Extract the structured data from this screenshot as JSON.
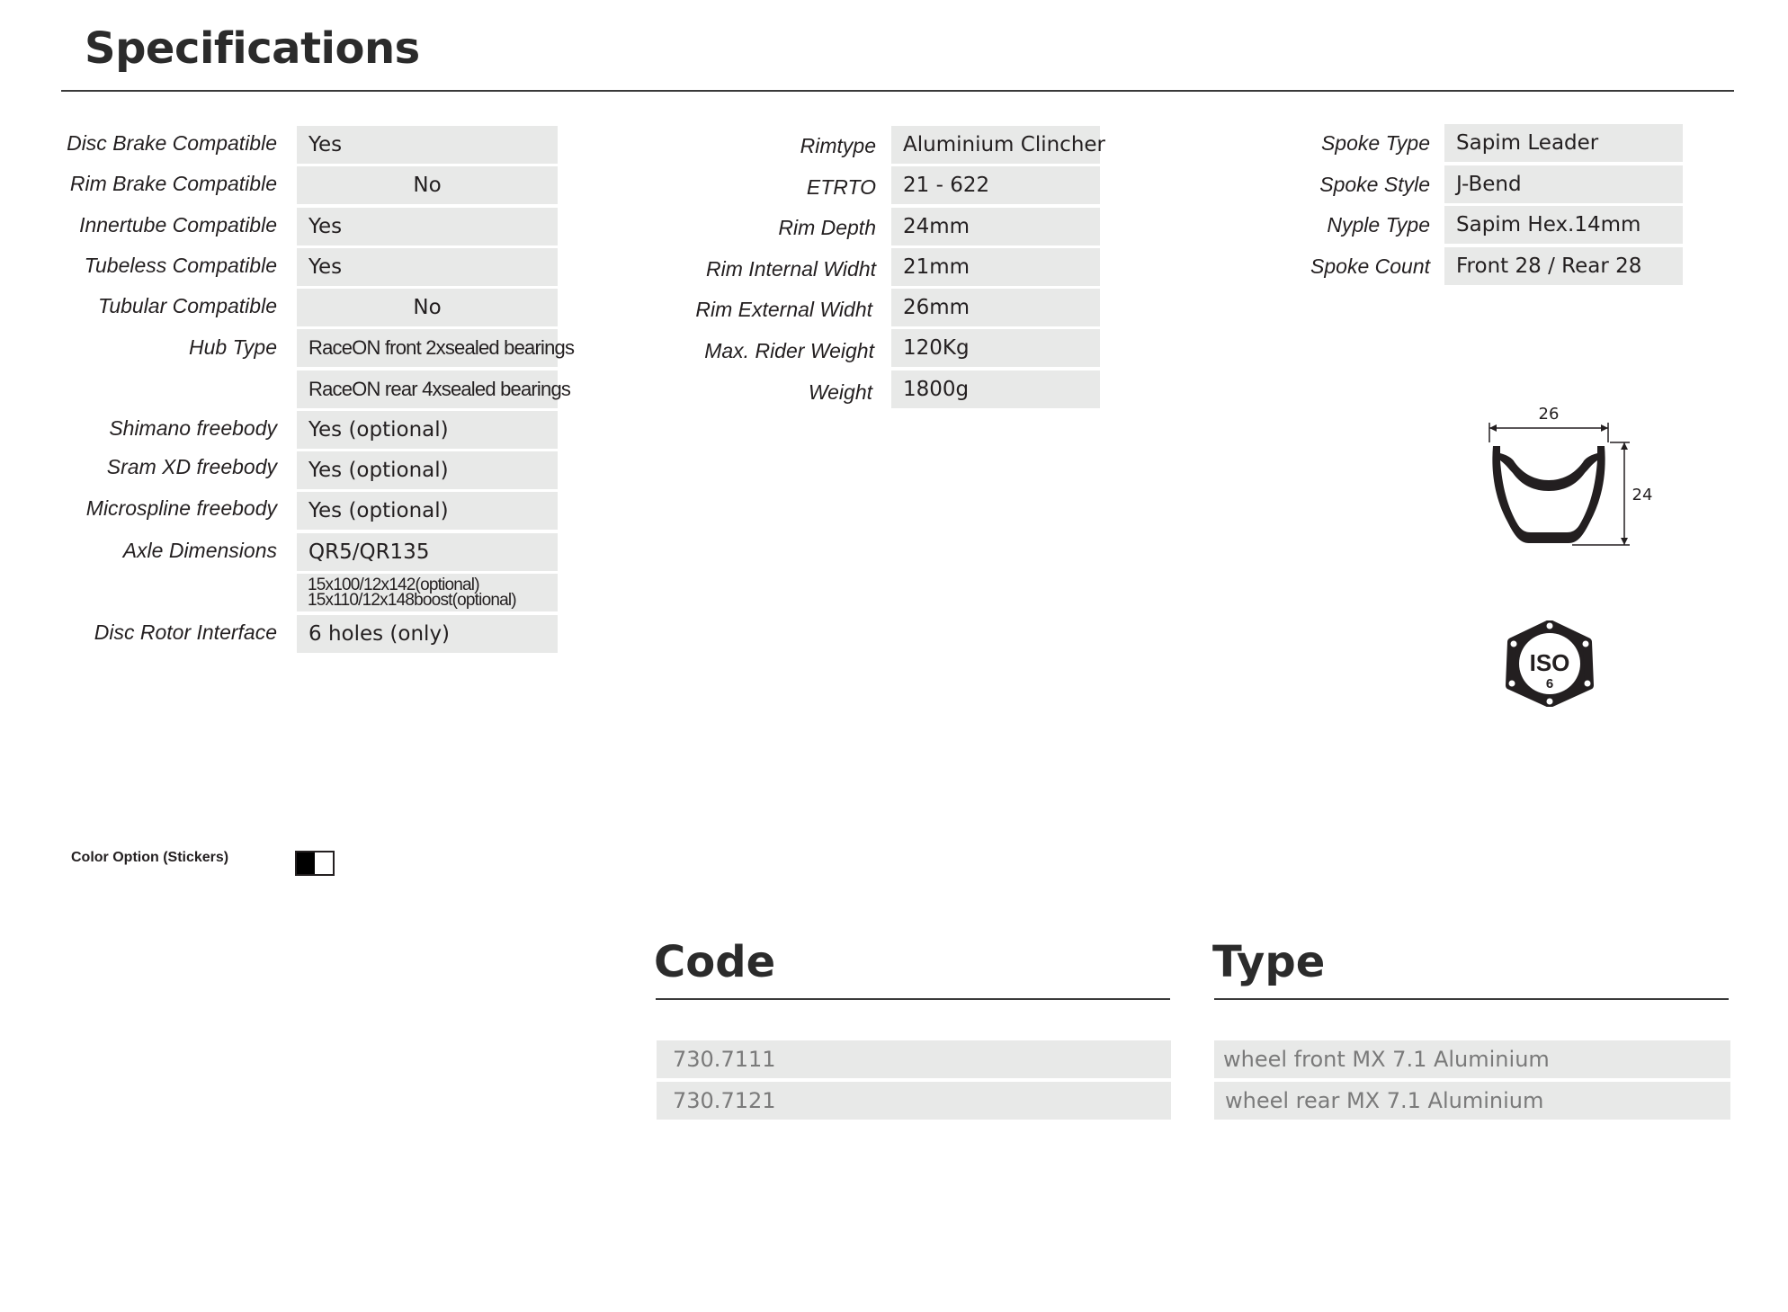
{
  "title": "Specifications",
  "col1": {
    "labels": [
      "Disc Brake Compatible",
      "Rim Brake Compatible",
      "Innertube Compatible",
      "Tubeless Compatible",
      "Tubular Compatible",
      "Hub Type",
      "Shimano freebody",
      "Sram XD freebody",
      "Microspline freebody",
      "Axle Dimensions",
      "Disc Rotor Interface"
    ],
    "values": [
      "Yes",
      "No",
      "Yes",
      "Yes",
      "No",
      "RaceON front 2xsealed bearings",
      "RaceON rear 4xsealed bearings",
      "Yes (optional)",
      "Yes (optional)",
      "Yes (optional)",
      "QR5/QR135",
      "15x100/12x142(optional)",
      "15x110/12x148boost(optional)",
      "6 holes (only)"
    ]
  },
  "col2": {
    "labels": [
      "Rimtype",
      "ETRTO",
      "Rim Depth",
      "Rim Internal Widht",
      "Rim External Widht",
      "Max. Rider Weight",
      "Weight"
    ],
    "values": [
      "Aluminium Clincher",
      "21 - 622",
      "24mm",
      "21mm",
      "26mm",
      "120Kg",
      "1800g"
    ]
  },
  "col3": {
    "labels": [
      "Spoke Type",
      "Spoke Style",
      "Nyple Type",
      "Spoke Count"
    ],
    "values": [
      "Sapim Leader",
      "J-Bend",
      "Sapim Hex.14mm",
      "Front 28 / Rear 28"
    ]
  },
  "rim_diagram": {
    "width_label": "26",
    "depth_label": "24"
  },
  "iso_badge": {
    "text": "ISO",
    "number": "6"
  },
  "color_option": {
    "label": "Color Option (Stickers)",
    "colors": [
      "#000000",
      "#ffffff"
    ]
  },
  "code_section": {
    "heading": "Code",
    "rows": [
      "730.7111",
      "730.7121"
    ]
  },
  "type_section": {
    "heading": "Type",
    "rows": [
      "wheel front MX 7.1 Aluminium",
      "wheel rear MX 7.1 Aluminium"
    ]
  }
}
